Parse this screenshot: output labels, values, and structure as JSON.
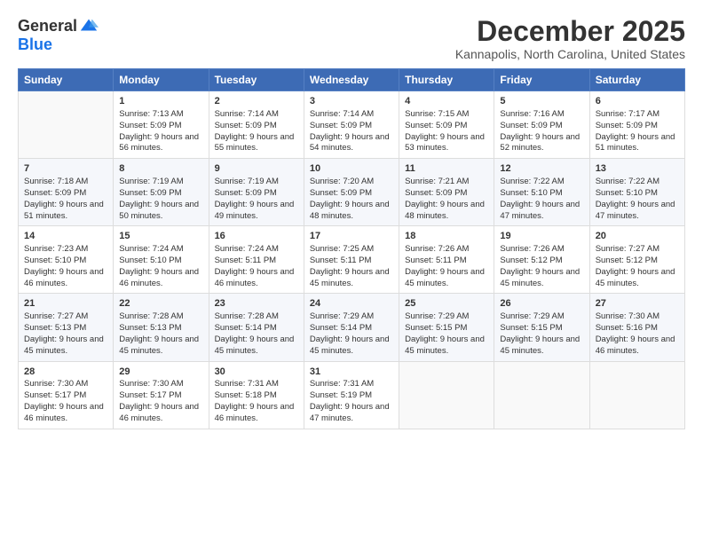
{
  "logo": {
    "general": "General",
    "blue": "Blue"
  },
  "title": "December 2025",
  "location": "Kannapolis, North Carolina, United States",
  "days": [
    "Sunday",
    "Monday",
    "Tuesday",
    "Wednesday",
    "Thursday",
    "Friday",
    "Saturday"
  ],
  "weeks": [
    [
      {
        "num": "",
        "sunrise": "",
        "sunset": "",
        "daylight": ""
      },
      {
        "num": "1",
        "sunrise": "Sunrise: 7:13 AM",
        "sunset": "Sunset: 5:09 PM",
        "daylight": "Daylight: 9 hours and 56 minutes."
      },
      {
        "num": "2",
        "sunrise": "Sunrise: 7:14 AM",
        "sunset": "Sunset: 5:09 PM",
        "daylight": "Daylight: 9 hours and 55 minutes."
      },
      {
        "num": "3",
        "sunrise": "Sunrise: 7:14 AM",
        "sunset": "Sunset: 5:09 PM",
        "daylight": "Daylight: 9 hours and 54 minutes."
      },
      {
        "num": "4",
        "sunrise": "Sunrise: 7:15 AM",
        "sunset": "Sunset: 5:09 PM",
        "daylight": "Daylight: 9 hours and 53 minutes."
      },
      {
        "num": "5",
        "sunrise": "Sunrise: 7:16 AM",
        "sunset": "Sunset: 5:09 PM",
        "daylight": "Daylight: 9 hours and 52 minutes."
      },
      {
        "num": "6",
        "sunrise": "Sunrise: 7:17 AM",
        "sunset": "Sunset: 5:09 PM",
        "daylight": "Daylight: 9 hours and 51 minutes."
      }
    ],
    [
      {
        "num": "7",
        "sunrise": "Sunrise: 7:18 AM",
        "sunset": "Sunset: 5:09 PM",
        "daylight": "Daylight: 9 hours and 51 minutes."
      },
      {
        "num": "8",
        "sunrise": "Sunrise: 7:19 AM",
        "sunset": "Sunset: 5:09 PM",
        "daylight": "Daylight: 9 hours and 50 minutes."
      },
      {
        "num": "9",
        "sunrise": "Sunrise: 7:19 AM",
        "sunset": "Sunset: 5:09 PM",
        "daylight": "Daylight: 9 hours and 49 minutes."
      },
      {
        "num": "10",
        "sunrise": "Sunrise: 7:20 AM",
        "sunset": "Sunset: 5:09 PM",
        "daylight": "Daylight: 9 hours and 48 minutes."
      },
      {
        "num": "11",
        "sunrise": "Sunrise: 7:21 AM",
        "sunset": "Sunset: 5:09 PM",
        "daylight": "Daylight: 9 hours and 48 minutes."
      },
      {
        "num": "12",
        "sunrise": "Sunrise: 7:22 AM",
        "sunset": "Sunset: 5:10 PM",
        "daylight": "Daylight: 9 hours and 47 minutes."
      },
      {
        "num": "13",
        "sunrise": "Sunrise: 7:22 AM",
        "sunset": "Sunset: 5:10 PM",
        "daylight": "Daylight: 9 hours and 47 minutes."
      }
    ],
    [
      {
        "num": "14",
        "sunrise": "Sunrise: 7:23 AM",
        "sunset": "Sunset: 5:10 PM",
        "daylight": "Daylight: 9 hours and 46 minutes."
      },
      {
        "num": "15",
        "sunrise": "Sunrise: 7:24 AM",
        "sunset": "Sunset: 5:10 PM",
        "daylight": "Daylight: 9 hours and 46 minutes."
      },
      {
        "num": "16",
        "sunrise": "Sunrise: 7:24 AM",
        "sunset": "Sunset: 5:11 PM",
        "daylight": "Daylight: 9 hours and 46 minutes."
      },
      {
        "num": "17",
        "sunrise": "Sunrise: 7:25 AM",
        "sunset": "Sunset: 5:11 PM",
        "daylight": "Daylight: 9 hours and 45 minutes."
      },
      {
        "num": "18",
        "sunrise": "Sunrise: 7:26 AM",
        "sunset": "Sunset: 5:11 PM",
        "daylight": "Daylight: 9 hours and 45 minutes."
      },
      {
        "num": "19",
        "sunrise": "Sunrise: 7:26 AM",
        "sunset": "Sunset: 5:12 PM",
        "daylight": "Daylight: 9 hours and 45 minutes."
      },
      {
        "num": "20",
        "sunrise": "Sunrise: 7:27 AM",
        "sunset": "Sunset: 5:12 PM",
        "daylight": "Daylight: 9 hours and 45 minutes."
      }
    ],
    [
      {
        "num": "21",
        "sunrise": "Sunrise: 7:27 AM",
        "sunset": "Sunset: 5:13 PM",
        "daylight": "Daylight: 9 hours and 45 minutes."
      },
      {
        "num": "22",
        "sunrise": "Sunrise: 7:28 AM",
        "sunset": "Sunset: 5:13 PM",
        "daylight": "Daylight: 9 hours and 45 minutes."
      },
      {
        "num": "23",
        "sunrise": "Sunrise: 7:28 AM",
        "sunset": "Sunset: 5:14 PM",
        "daylight": "Daylight: 9 hours and 45 minutes."
      },
      {
        "num": "24",
        "sunrise": "Sunrise: 7:29 AM",
        "sunset": "Sunset: 5:14 PM",
        "daylight": "Daylight: 9 hours and 45 minutes."
      },
      {
        "num": "25",
        "sunrise": "Sunrise: 7:29 AM",
        "sunset": "Sunset: 5:15 PM",
        "daylight": "Daylight: 9 hours and 45 minutes."
      },
      {
        "num": "26",
        "sunrise": "Sunrise: 7:29 AM",
        "sunset": "Sunset: 5:15 PM",
        "daylight": "Daylight: 9 hours and 45 minutes."
      },
      {
        "num": "27",
        "sunrise": "Sunrise: 7:30 AM",
        "sunset": "Sunset: 5:16 PM",
        "daylight": "Daylight: 9 hours and 46 minutes."
      }
    ],
    [
      {
        "num": "28",
        "sunrise": "Sunrise: 7:30 AM",
        "sunset": "Sunset: 5:17 PM",
        "daylight": "Daylight: 9 hours and 46 minutes."
      },
      {
        "num": "29",
        "sunrise": "Sunrise: 7:30 AM",
        "sunset": "Sunset: 5:17 PM",
        "daylight": "Daylight: 9 hours and 46 minutes."
      },
      {
        "num": "30",
        "sunrise": "Sunrise: 7:31 AM",
        "sunset": "Sunset: 5:18 PM",
        "daylight": "Daylight: 9 hours and 46 minutes."
      },
      {
        "num": "31",
        "sunrise": "Sunrise: 7:31 AM",
        "sunset": "Sunset: 5:19 PM",
        "daylight": "Daylight: 9 hours and 47 minutes."
      },
      {
        "num": "",
        "sunrise": "",
        "sunset": "",
        "daylight": ""
      },
      {
        "num": "",
        "sunrise": "",
        "sunset": "",
        "daylight": ""
      },
      {
        "num": "",
        "sunrise": "",
        "sunset": "",
        "daylight": ""
      }
    ]
  ]
}
